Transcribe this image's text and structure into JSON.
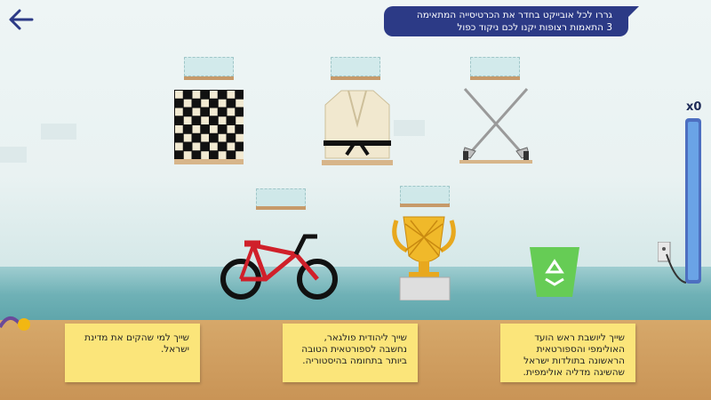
{
  "instructions": {
    "line1": "גררו לכל אובייקט בחדר את הכרטיסייה המתאימה",
    "line2": "3 התאמות רצופות יקנו לכם ניקוד כפול"
  },
  "score": {
    "label": "x0"
  },
  "cards": [
    {
      "text": "שייך למי שהקים את מדינת ישראל."
    },
    {
      "text": "שייך ליהודית פולגאר, נחשבה לספורטאית הטובה ביותר בתחומה בהיסטוריה."
    },
    {
      "text": "שייך ליושבת ראש הועד האולימפי והספורטאית הראשונה בתולדות ישראל שהשיגה מדליה אולימפית."
    }
  ],
  "objects": {
    "top": [
      "chessboard-icon",
      "judo-uniform-icon",
      "fencing-swords-icon"
    ],
    "bottom": [
      "bicycle-icon",
      "trophy-icon"
    ]
  },
  "icons": {
    "back": "back-arrow-icon",
    "bin": "recycle-bin-icon"
  },
  "colors": {
    "instructions_bg": "#2c3a86",
    "card_bg": "#fbe57a",
    "meter": "#4d6fc0",
    "bin": "#66cc55"
  }
}
